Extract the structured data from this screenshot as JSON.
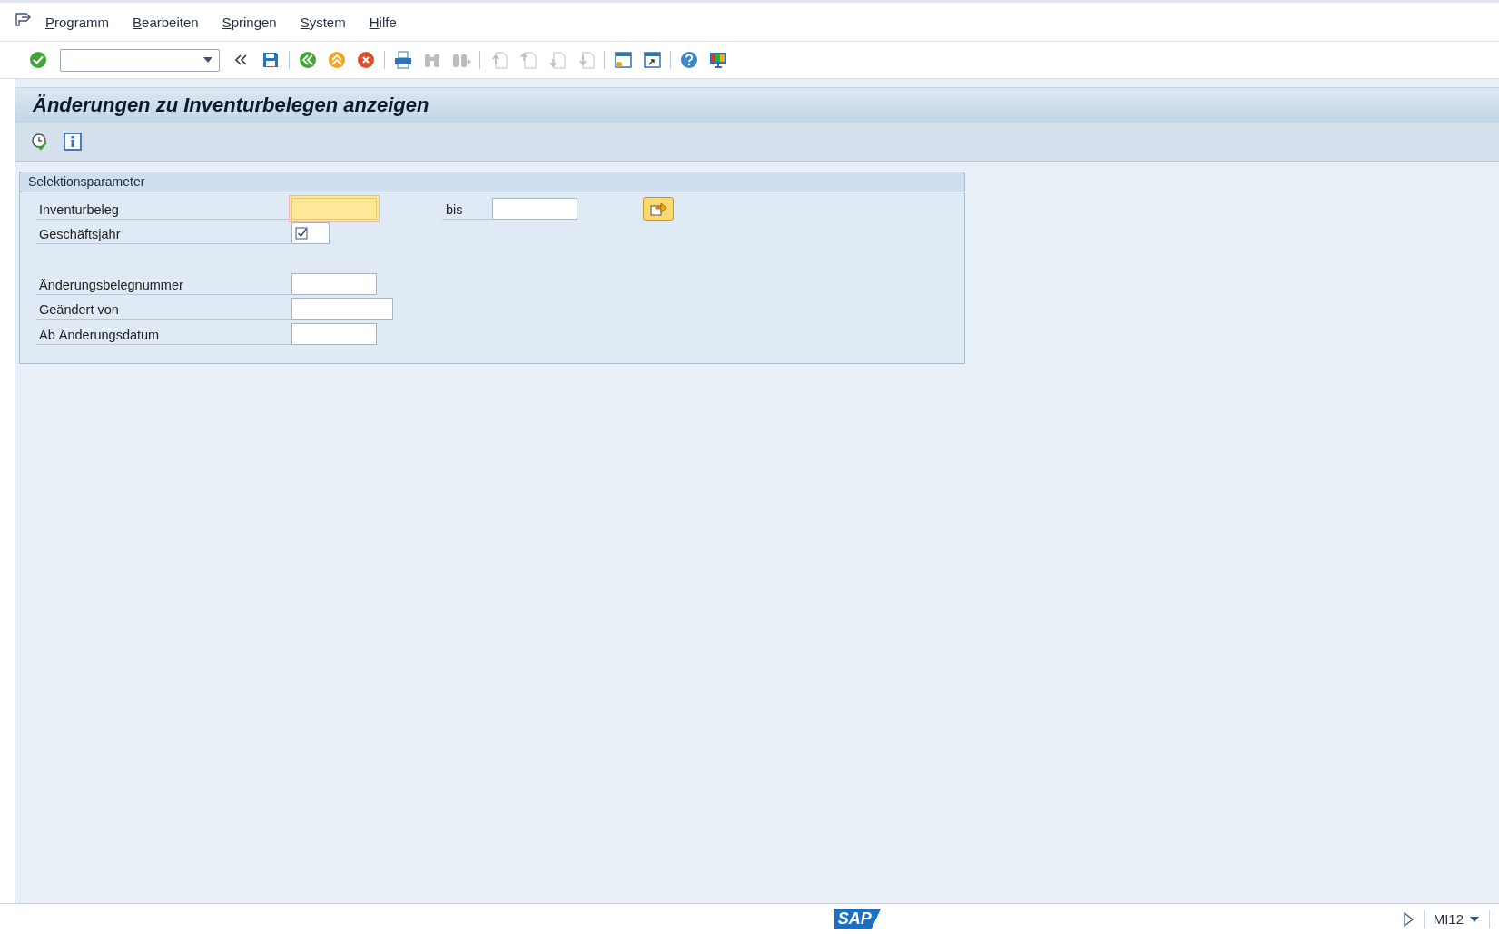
{
  "menu": [
    {
      "label": "Programm"
    },
    {
      "label": "Bearbeiten"
    },
    {
      "label": "Springen"
    },
    {
      "label": "System"
    },
    {
      "label": "Hilfe"
    }
  ],
  "toolbar": [
    {
      "kind": "enter",
      "disabled": false
    },
    {
      "kind": "command_field"
    },
    {
      "kind": "collapse",
      "disabled": false
    },
    {
      "kind": "save",
      "disabled": false
    },
    {
      "kind": "separator"
    },
    {
      "kind": "back",
      "disabled": false
    },
    {
      "kind": "exit",
      "disabled": false
    },
    {
      "kind": "cancel",
      "disabled": false
    },
    {
      "kind": "separator"
    },
    {
      "kind": "print",
      "disabled": false
    },
    {
      "kind": "find",
      "disabled": true
    },
    {
      "kind": "find_next",
      "disabled": true
    },
    {
      "kind": "separator"
    },
    {
      "kind": "first_page",
      "disabled": true
    },
    {
      "kind": "previous_page",
      "disabled": true
    },
    {
      "kind": "next_page",
      "disabled": true
    },
    {
      "kind": "last_page",
      "disabled": true
    },
    {
      "kind": "separator"
    },
    {
      "kind": "new_session",
      "disabled": false
    },
    {
      "kind": "shortcut",
      "disabled": false
    },
    {
      "kind": "separator"
    },
    {
      "kind": "help",
      "disabled": false
    },
    {
      "kind": "layout",
      "disabled": false
    }
  ],
  "title": "Änderungen zu Inventurbelegen anzeigen",
  "app_toolbar": [
    {
      "kind": "execute"
    },
    {
      "kind": "info"
    }
  ],
  "group": {
    "title": "Selektionsparameter",
    "rows": [
      {
        "kind": "range",
        "label": "Inventurbeleg",
        "focused": true,
        "to_label": "bis"
      },
      {
        "kind": "checkbox",
        "label": "Geschäftsjahr",
        "checked": true
      },
      {
        "kind": "spacer"
      },
      {
        "kind": "input",
        "label": "Änderungsbelegnummer",
        "wide": false
      },
      {
        "kind": "input",
        "label": "Geändert von",
        "wide": true
      },
      {
        "kind": "input",
        "label": "Ab Änderungsdatum",
        "wide": false
      }
    ]
  },
  "status_bar": {
    "logo": "SAP",
    "transaction": "MI12"
  }
}
